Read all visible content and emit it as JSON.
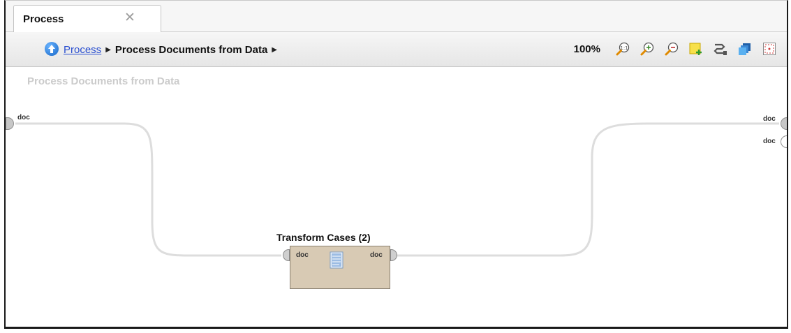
{
  "tab": {
    "title": "Process",
    "close_glyph": "✕"
  },
  "breadcrumb": {
    "root": "Process",
    "current": "Process Documents from Data",
    "separator": "▶"
  },
  "toolbar": {
    "zoom": "100%",
    "icons": [
      "zoom-actual-icon",
      "zoom-in-icon",
      "zoom-out-icon",
      "add-note-icon",
      "auto-wire-icon",
      "layers-icon",
      "fit-view-icon"
    ]
  },
  "canvas": {
    "title": "Process Documents from Data",
    "left_port_label": "doc",
    "right_port_labels": [
      "doc",
      "doc"
    ]
  },
  "operator": {
    "title": "Transform Cases (2)",
    "in_port": "doc",
    "out_port": "doc",
    "fill_color": "#d8cab4"
  },
  "colors": {
    "link": "#2a4fd0",
    "accent": "#1867c7"
  }
}
